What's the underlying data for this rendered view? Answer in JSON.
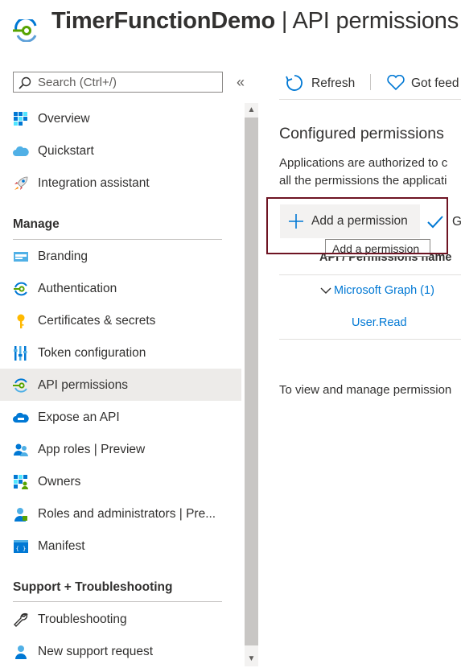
{
  "header": {
    "app_name": "TimerFunctionDemo",
    "separator": "|",
    "blade_title": "API permissions"
  },
  "search": {
    "placeholder": "Search (Ctrl+/)"
  },
  "collapse_glyph": "«",
  "nav": {
    "top_items": [
      {
        "label": "Overview",
        "icon": "overview-grid-icon"
      },
      {
        "label": "Quickstart",
        "icon": "cloud-icon"
      },
      {
        "label": "Integration assistant",
        "icon": "rocket-icon"
      }
    ],
    "manage_header": "Manage",
    "manage_items": [
      {
        "label": "Branding",
        "icon": "branding-icon"
      },
      {
        "label": "Authentication",
        "icon": "authentication-icon"
      },
      {
        "label": "Certificates & secrets",
        "icon": "key-icon"
      },
      {
        "label": "Token configuration",
        "icon": "token-bars-icon"
      },
      {
        "label": "API permissions",
        "icon": "api-permissions-icon",
        "active": true
      },
      {
        "label": "Expose an API",
        "icon": "cloud-api-icon"
      },
      {
        "label": "App roles | Preview",
        "icon": "users-icon"
      },
      {
        "label": "Owners",
        "icon": "owners-grid-icon"
      },
      {
        "label": "Roles and administrators | Pre...",
        "icon": "admin-person-icon"
      },
      {
        "label": "Manifest",
        "icon": "manifest-icon"
      }
    ],
    "support_header": "Support + Troubleshooting",
    "support_items": [
      {
        "label": "Troubleshooting",
        "icon": "wrench-icon"
      },
      {
        "label": "New support request",
        "icon": "support-person-icon"
      }
    ]
  },
  "toolbar": {
    "refresh_label": "Refresh",
    "feedback_label": "Got feed"
  },
  "main": {
    "section_title": "Configured permissions",
    "description_line1": "Applications are authorized to c",
    "description_line2": "all the permissions the applicati",
    "add_permission_label": "Add a permission",
    "grant_label": "G",
    "tooltip": "Add a permission",
    "column_header": "API / Permissions name",
    "group_row": "Microsoft Graph (1)",
    "permission_row": "User.Read",
    "footer_text": "To view and manage permission"
  },
  "colors": {
    "accent": "#0078d4",
    "highlight_border": "#6e1423",
    "active_bg": "#edebe9"
  }
}
